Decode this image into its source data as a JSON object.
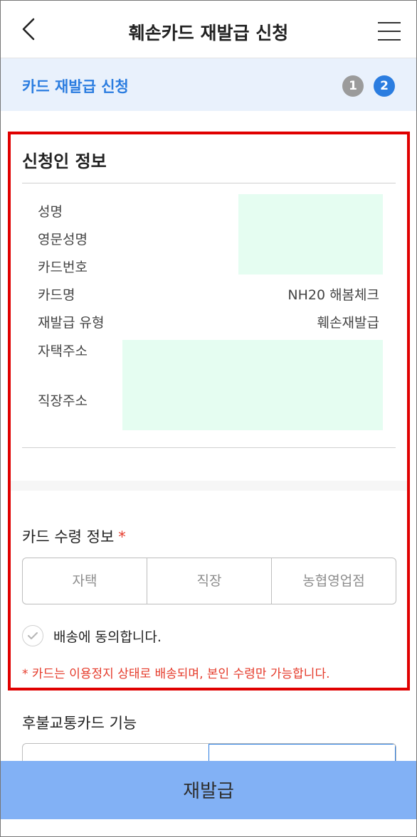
{
  "header": {
    "title": "훼손카드 재발급 신청",
    "back_icon": "chevron-left-icon",
    "menu_icon": "hamburger-menu-icon"
  },
  "stepbar": {
    "title": "카드 재발급 신청",
    "steps": [
      "1",
      "2"
    ],
    "active_step": "2"
  },
  "applicant": {
    "title": "신청인 정보",
    "rows": [
      {
        "label": "성명",
        "value": ""
      },
      {
        "label": "영문성명",
        "value": ""
      },
      {
        "label": "카드번호",
        "value": ""
      },
      {
        "label": "카드명",
        "value": "NH20 해봄체크"
      },
      {
        "label": "재발급 유형",
        "value": "훼손재발급"
      },
      {
        "label": "자택주소",
        "value": ""
      },
      {
        "label": "직장주소",
        "value": ""
      }
    ]
  },
  "receipt": {
    "title": "카드 수령 정보",
    "required_mark": "*",
    "options": [
      "자택",
      "직장",
      "농협영업점"
    ],
    "agree_text": "배송에 동의합니다.",
    "notice": "* 카드는 이용정지 상태로 배송되며, 본인 수령만 가능합니다."
  },
  "transit": {
    "title": "후불교통카드 기능"
  },
  "bottom": {
    "button_label": "재발급"
  },
  "colors": {
    "accent": "#2b7de0",
    "highlight_border": "#e00000",
    "notice": "#e53a2a",
    "button_bg": "#82b1f5"
  }
}
